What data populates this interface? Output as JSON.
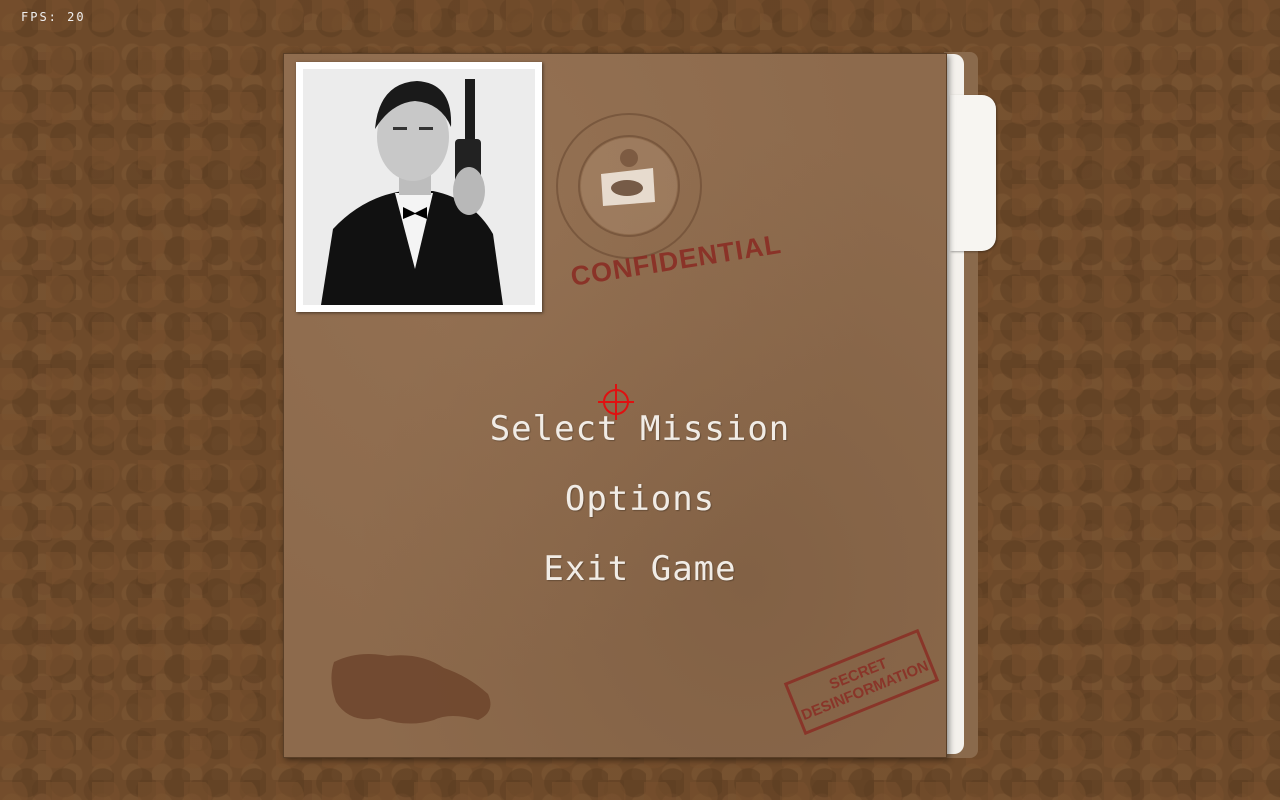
{
  "hud": {
    "fps": "FPS: 20"
  },
  "folder": {
    "photo": {
      "icon": "agent-portrait-photo"
    },
    "seal": {
      "icon": "state-seal-emblem"
    },
    "stamp_confidential": "CONFIDENTIAL",
    "stamp_secret": {
      "line1": "SECRET",
      "line2": "DESINFORMATION"
    }
  },
  "menu": {
    "items": [
      {
        "label": "Select Mission"
      },
      {
        "label": "Options"
      },
      {
        "label": "Exit Game"
      }
    ],
    "cursor_icon": "crosshair-icon"
  },
  "colors": {
    "background": "#6e4a2a",
    "folder": "#8d6a4c",
    "menu_text": "#f1ece6",
    "stamp": "#8a2a22",
    "crosshair": "#e01010"
  }
}
